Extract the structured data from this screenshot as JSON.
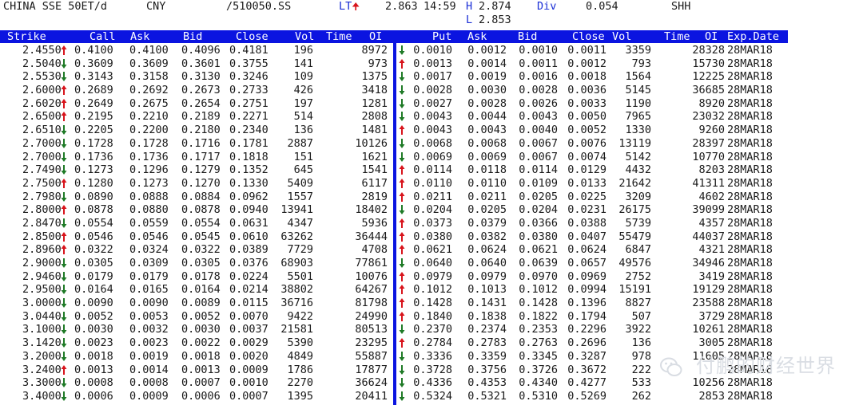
{
  "header": {
    "instrument": "CHINA SSE 50ET/d",
    "currency": "CNY",
    "ric": "/510050.SS",
    "lt_label": "LT",
    "last_price": "2.863",
    "time": "14:59",
    "h_label": "H",
    "high": "2.874",
    "l_label": "L",
    "low": "2.853",
    "div_label": "Div",
    "div": "0.054",
    "exchange": "SHH"
  },
  "columns": {
    "strike": "Strike",
    "call": "Call",
    "ask": "Ask",
    "bid": "Bid",
    "close": "Close",
    "vol": "Vol",
    "time": "Time",
    "oi": "OI",
    "put": "Put",
    "put_ask": "Ask",
    "put_bid": "Bid",
    "put_close": "Close",
    "put_vol": "Vol",
    "put_time": "Time",
    "put_oi": "OI",
    "exp": "Exp.Date"
  },
  "colors": {
    "header_bg": "#0b14e0",
    "up": "#d8131b",
    "down": "#1e7a26",
    "label_blue": "#1b2fd6"
  },
  "rows": [
    {
      "strike": "2.4550",
      "strike_dir": "up",
      "call": "0.4100",
      "ask": "0.4100",
      "bid": "0.4096",
      "close": "0.4181",
      "vol": "196",
      "oi": "8972",
      "put_dir": "down",
      "put": "0.0010",
      "put_ask": "0.0012",
      "put_bid": "0.0010",
      "put_close": "0.0011",
      "put_vol": "3359",
      "put_oi": "28328",
      "exp": "28MAR18"
    },
    {
      "strike": "2.5040",
      "strike_dir": "down",
      "call": "0.3609",
      "ask": "0.3609",
      "bid": "0.3601",
      "close": "0.3755",
      "vol": "141",
      "oi": "973",
      "put_dir": "up",
      "put": "0.0013",
      "put_ask": "0.0014",
      "put_bid": "0.0011",
      "put_close": "0.0012",
      "put_vol": "793",
      "put_oi": "15730",
      "exp": "28MAR18"
    },
    {
      "strike": "2.5530",
      "strike_dir": "down",
      "call": "0.3143",
      "ask": "0.3158",
      "bid": "0.3130",
      "close": "0.3246",
      "vol": "109",
      "oi": "1375",
      "put_dir": "down",
      "put": "0.0017",
      "put_ask": "0.0019",
      "put_bid": "0.0016",
      "put_close": "0.0018",
      "put_vol": "1564",
      "put_oi": "12225",
      "exp": "28MAR18"
    },
    {
      "strike": "2.6000",
      "strike_dir": "up",
      "call": "0.2689",
      "ask": "0.2692",
      "bid": "0.2673",
      "close": "0.2733",
      "vol": "426",
      "oi": "3418",
      "put_dir": "down",
      "put": "0.0028",
      "put_ask": "0.0030",
      "put_bid": "0.0028",
      "put_close": "0.0036",
      "put_vol": "5145",
      "put_oi": "36685",
      "exp": "28MAR18"
    },
    {
      "strike": "2.6020",
      "strike_dir": "up",
      "call": "0.2649",
      "ask": "0.2675",
      "bid": "0.2654",
      "close": "0.2751",
      "vol": "197",
      "oi": "1281",
      "put_dir": "down",
      "put": "0.0027",
      "put_ask": "0.0028",
      "put_bid": "0.0026",
      "put_close": "0.0033",
      "put_vol": "1190",
      "put_oi": "8920",
      "exp": "28MAR18"
    },
    {
      "strike": "2.6500",
      "strike_dir": "up",
      "call": "0.2195",
      "ask": "0.2210",
      "bid": "0.2189",
      "close": "0.2271",
      "vol": "514",
      "oi": "2808",
      "put_dir": "down",
      "put": "0.0043",
      "put_ask": "0.0044",
      "put_bid": "0.0043",
      "put_close": "0.0050",
      "put_vol": "7965",
      "put_oi": "23032",
      "exp": "28MAR18"
    },
    {
      "strike": "2.6510",
      "strike_dir": "down",
      "call": "0.2205",
      "ask": "0.2200",
      "bid": "0.2180",
      "close": "0.2340",
      "vol": "136",
      "oi": "1481",
      "put_dir": "up",
      "put": "0.0043",
      "put_ask": "0.0043",
      "put_bid": "0.0040",
      "put_close": "0.0052",
      "put_vol": "1330",
      "put_oi": "9260",
      "exp": "28MAR18"
    },
    {
      "strike": "2.7000",
      "strike_dir": "down",
      "call": "0.1728",
      "ask": "0.1728",
      "bid": "0.1716",
      "close": "0.1781",
      "vol": "2887",
      "oi": "10126",
      "put_dir": "down",
      "put": "0.0068",
      "put_ask": "0.0068",
      "put_bid": "0.0067",
      "put_close": "0.0076",
      "put_vol": "13119",
      "put_oi": "28397",
      "exp": "28MAR18"
    },
    {
      "strike": "2.7000",
      "strike_dir": "down",
      "call": "0.1736",
      "ask": "0.1736",
      "bid": "0.1717",
      "close": "0.1818",
      "vol": "151",
      "oi": "1621",
      "put_dir": "down",
      "put": "0.0069",
      "put_ask": "0.0069",
      "put_bid": "0.0067",
      "put_close": "0.0074",
      "put_vol": "5142",
      "put_oi": "10770",
      "exp": "28MAR18"
    },
    {
      "strike": "2.7490",
      "strike_dir": "down",
      "call": "0.1273",
      "ask": "0.1296",
      "bid": "0.1279",
      "close": "0.1352",
      "vol": "645",
      "oi": "1541",
      "put_dir": "up",
      "put": "0.0114",
      "put_ask": "0.0118",
      "put_bid": "0.0114",
      "put_close": "0.0129",
      "put_vol": "4432",
      "put_oi": "8203",
      "exp": "28MAR18"
    },
    {
      "strike": "2.7500",
      "strike_dir": "up",
      "call": "0.1280",
      "ask": "0.1273",
      "bid": "0.1270",
      "close": "0.1330",
      "vol": "5409",
      "oi": "6117",
      "put_dir": "up",
      "put": "0.0110",
      "put_ask": "0.0110",
      "put_bid": "0.0109",
      "put_close": "0.0133",
      "put_vol": "21642",
      "put_oi": "41311",
      "exp": "28MAR18"
    },
    {
      "strike": "2.7980",
      "strike_dir": "down",
      "call": "0.0890",
      "ask": "0.0888",
      "bid": "0.0884",
      "close": "0.0962",
      "vol": "1557",
      "oi": "2819",
      "put_dir": "up",
      "put": "0.0211",
      "put_ask": "0.0211",
      "put_bid": "0.0205",
      "put_close": "0.0225",
      "put_vol": "3209",
      "put_oi": "4602",
      "exp": "28MAR18"
    },
    {
      "strike": "2.8000",
      "strike_dir": "up",
      "call": "0.0878",
      "ask": "0.0880",
      "bid": "0.0878",
      "close": "0.0940",
      "vol": "13941",
      "oi": "18402",
      "put_dir": "down",
      "put": "0.0204",
      "put_ask": "0.0205",
      "put_bid": "0.0204",
      "put_close": "0.0231",
      "put_vol": "26175",
      "put_oi": "39099",
      "exp": "28MAR18"
    },
    {
      "strike": "2.8470",
      "strike_dir": "down",
      "call": "0.0554",
      "ask": "0.0559",
      "bid": "0.0554",
      "close": "0.0631",
      "vol": "4347",
      "oi": "5936",
      "put_dir": "up",
      "put": "0.0373",
      "put_ask": "0.0379",
      "put_bid": "0.0366",
      "put_close": "0.0388",
      "put_vol": "5739",
      "put_oi": "4357",
      "exp": "28MAR18"
    },
    {
      "strike": "2.8500",
      "strike_dir": "up",
      "call": "0.0546",
      "ask": "0.0546",
      "bid": "0.0545",
      "close": "0.0610",
      "vol": "63262",
      "oi": "36444",
      "put_dir": "up",
      "put": "0.0380",
      "put_ask": "0.0382",
      "put_bid": "0.0380",
      "put_close": "0.0407",
      "put_vol": "55479",
      "put_oi": "44037",
      "exp": "28MAR18"
    },
    {
      "strike": "2.8960",
      "strike_dir": "up",
      "call": "0.0322",
      "ask": "0.0324",
      "bid": "0.0322",
      "close": "0.0389",
      "vol": "7729",
      "oi": "4708",
      "put_dir": "up",
      "put": "0.0621",
      "put_ask": "0.0624",
      "put_bid": "0.0621",
      "put_close": "0.0624",
      "put_vol": "6847",
      "put_oi": "4321",
      "exp": "28MAR18"
    },
    {
      "strike": "2.9000",
      "strike_dir": "down",
      "call": "0.0305",
      "ask": "0.0309",
      "bid": "0.0305",
      "close": "0.0376",
      "vol": "68903",
      "oi": "77861",
      "put_dir": "down",
      "put": "0.0640",
      "put_ask": "0.0640",
      "put_bid": "0.0639",
      "put_close": "0.0657",
      "put_vol": "49576",
      "put_oi": "34946",
      "exp": "28MAR18"
    },
    {
      "strike": "2.9460",
      "strike_dir": "down",
      "call": "0.0179",
      "ask": "0.0179",
      "bid": "0.0178",
      "close": "0.0224",
      "vol": "5501",
      "oi": "10076",
      "put_dir": "up",
      "put": "0.0979",
      "put_ask": "0.0979",
      "put_bid": "0.0970",
      "put_close": "0.0969",
      "put_vol": "2752",
      "put_oi": "3419",
      "exp": "28MAR18"
    },
    {
      "strike": "2.9500",
      "strike_dir": "down",
      "call": "0.0164",
      "ask": "0.0165",
      "bid": "0.0164",
      "close": "0.0214",
      "vol": "38802",
      "oi": "64267",
      "put_dir": "up",
      "put": "0.1012",
      "put_ask": "0.1013",
      "put_bid": "0.1012",
      "put_close": "0.0994",
      "put_vol": "15191",
      "put_oi": "19129",
      "exp": "28MAR18"
    },
    {
      "strike": "3.0000",
      "strike_dir": "down",
      "call": "0.0090",
      "ask": "0.0090",
      "bid": "0.0089",
      "close": "0.0115",
      "vol": "36716",
      "oi": "81798",
      "put_dir": "up",
      "put": "0.1428",
      "put_ask": "0.1431",
      "put_bid": "0.1428",
      "put_close": "0.1396",
      "put_vol": "8827",
      "put_oi": "23588",
      "exp": "28MAR18"
    },
    {
      "strike": "3.0440",
      "strike_dir": "down",
      "call": "0.0052",
      "ask": "0.0053",
      "bid": "0.0052",
      "close": "0.0070",
      "vol": "9422",
      "oi": "24990",
      "put_dir": "up",
      "put": "0.1840",
      "put_ask": "0.1838",
      "put_bid": "0.1822",
      "put_close": "0.1794",
      "put_vol": "507",
      "put_oi": "3729",
      "exp": "28MAR18"
    },
    {
      "strike": "3.1000",
      "strike_dir": "down",
      "call": "0.0030",
      "ask": "0.0032",
      "bid": "0.0030",
      "close": "0.0037",
      "vol": "21581",
      "oi": "80513",
      "put_dir": "down",
      "put": "0.2370",
      "put_ask": "0.2374",
      "put_bid": "0.2353",
      "put_close": "0.2296",
      "put_vol": "3922",
      "put_oi": "10261",
      "exp": "28MAR18"
    },
    {
      "strike": "3.1420",
      "strike_dir": "down",
      "call": "0.0023",
      "ask": "0.0023",
      "bid": "0.0022",
      "close": "0.0029",
      "vol": "5390",
      "oi": "23295",
      "put_dir": "up",
      "put": "0.2784",
      "put_ask": "0.2783",
      "put_bid": "0.2763",
      "put_close": "0.2696",
      "put_vol": "136",
      "put_oi": "3005",
      "exp": "28MAR18"
    },
    {
      "strike": "3.2000",
      "strike_dir": "down",
      "call": "0.0018",
      "ask": "0.0019",
      "bid": "0.0018",
      "close": "0.0020",
      "vol": "4849",
      "oi": "55887",
      "put_dir": "down",
      "put": "0.3336",
      "put_ask": "0.3359",
      "put_bid": "0.3345",
      "put_close": "0.3287",
      "put_vol": "978",
      "put_oi": "11605",
      "exp": "28MAR18"
    },
    {
      "strike": "3.2400",
      "strike_dir": "up",
      "call": "0.0013",
      "ask": "0.0014",
      "bid": "0.0013",
      "close": "0.0009",
      "vol": "1786",
      "oi": "17877",
      "put_dir": "down",
      "put": "0.3728",
      "put_ask": "0.3756",
      "put_bid": "0.3726",
      "put_close": "0.3672",
      "put_vol": "222",
      "put_oi": "",
      "exp": "28MAR18"
    },
    {
      "strike": "3.3000",
      "strike_dir": "down",
      "call": "0.0008",
      "ask": "0.0008",
      "bid": "0.0007",
      "close": "0.0010",
      "vol": "2270",
      "oi": "36624",
      "put_dir": "down",
      "put": "0.4336",
      "put_ask": "0.4353",
      "put_bid": "0.4340",
      "put_close": "0.4277",
      "put_vol": "533",
      "put_oi": "10256",
      "exp": "28MAR18"
    },
    {
      "strike": "3.4000",
      "strike_dir": "down",
      "call": "0.0006",
      "ask": "0.0009",
      "bid": "0.0006",
      "close": "0.0007",
      "vol": "1395",
      "oi": "20411",
      "put_dir": "down",
      "put": "0.5324",
      "put_ask": "0.5321",
      "put_bid": "0.5310",
      "put_close": "0.5269",
      "put_vol": "262",
      "put_oi": "2853",
      "exp": "28MAR18"
    }
  ],
  "watermark": {
    "icon": "wechat-logo-icon",
    "text": "付鹏的财经世界"
  }
}
